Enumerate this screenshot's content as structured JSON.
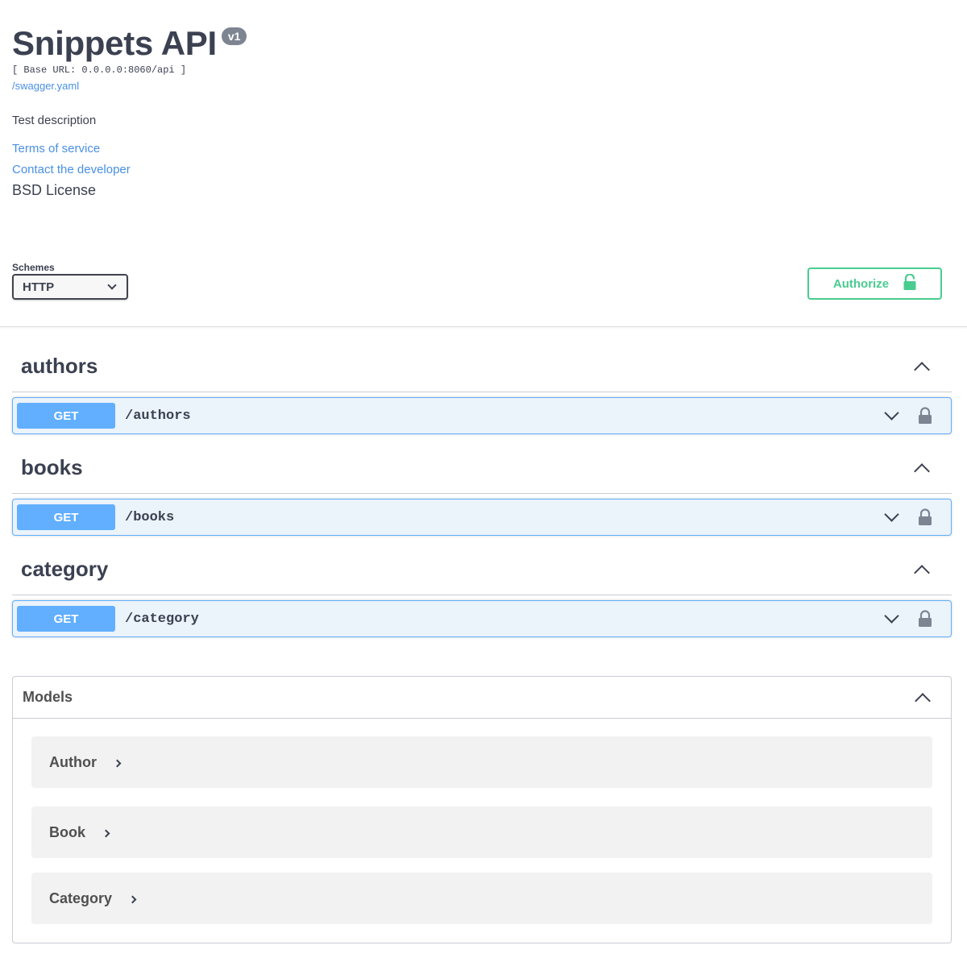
{
  "info": {
    "title": "Snippets API",
    "version": "v1",
    "base_url": "[ Base URL: 0.0.0.0:8060/api ]",
    "spec_link": "/swagger.yaml",
    "description": "Test description",
    "terms": "Terms of service",
    "contact": "Contact the developer",
    "license": "BSD License"
  },
  "schemes": {
    "label": "Schemes",
    "selected": "HTTP"
  },
  "authorize": {
    "label": "Authorize"
  },
  "tags": [
    {
      "name": "authors",
      "method": "GET",
      "path": "/authors"
    },
    {
      "name": "books",
      "method": "GET",
      "path": "/books"
    },
    {
      "name": "category",
      "method": "GET",
      "path": "/category"
    }
  ],
  "models": {
    "title": "Models",
    "items": [
      "Author",
      "Book",
      "Category"
    ]
  },
  "colors": {
    "get_method": "#61affe",
    "authorize": "#49cc90",
    "link": "#4990e2"
  },
  "icons": {
    "authorize": "unlocked-padlock-icon",
    "operation_lock": "padlock-icon",
    "collapse": "chevron-up-icon",
    "expand": "chevron-down-icon",
    "model_expand": "chevron-right-icon"
  }
}
